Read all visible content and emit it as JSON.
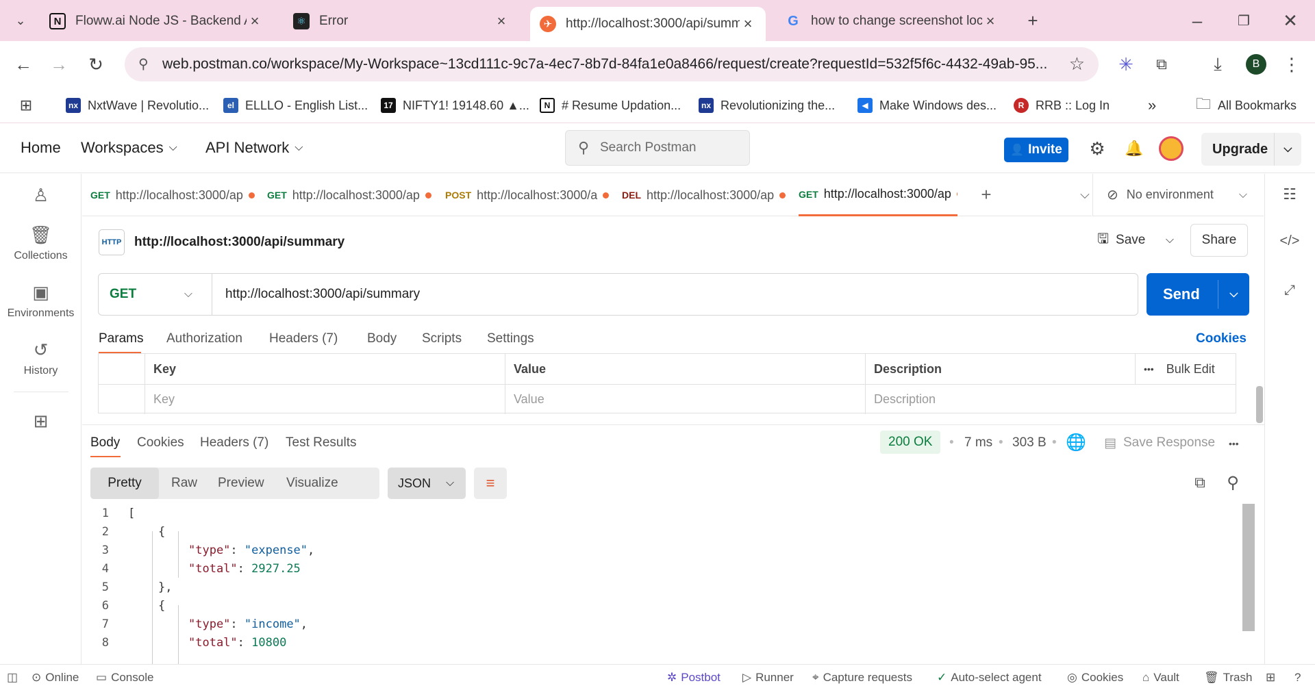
{
  "browser": {
    "tabs": [
      {
        "title": "Floww.ai Node JS - Backend As",
        "icon": "notion-icon"
      },
      {
        "title": "Error",
        "icon": "react-icon"
      },
      {
        "title": "http://localhost:3000/api/summ",
        "icon": "postman-icon",
        "active": true
      },
      {
        "title": "how to change screenshot locat",
        "icon": "google-icon"
      }
    ],
    "url": "web.postman.co/workspace/My-Workspace~13cd111c-9c7a-4ec7-8b7d-84fa1e0a8466/request/create?requestId=532f5f6c-4432-49ab-95...",
    "profile_initial": "B",
    "bookmarks": [
      {
        "label": "NxtWave | Revolutio...",
        "color": "#1f3a93"
      },
      {
        "label": "ELLLO - English List...",
        "color": "#2b5fb3"
      },
      {
        "label": "NIFTY1! 19148.60 ▲...",
        "color": "#111111"
      },
      {
        "label": "# Resume Updation...",
        "color": "#111111"
      },
      {
        "label": "Revolutionizing the...",
        "color": "#1f3a93"
      },
      {
        "label": "Make Windows des...",
        "color": "#1a73e8"
      },
      {
        "label": "RRB :: Log In",
        "color": "#c62828"
      }
    ],
    "all_bookmarks": "All Bookmarks"
  },
  "postman": {
    "nav": {
      "home": "Home",
      "workspaces": "Workspaces",
      "api_network": "API Network"
    },
    "search_placeholder": "Search Postman",
    "invite": "Invite",
    "upgrade": "Upgrade",
    "sidebar": [
      {
        "label": "",
        "icon": "user-icon"
      },
      {
        "label": "Collections",
        "icon": "collections-icon"
      },
      {
        "label": "Environments",
        "icon": "environments-icon"
      },
      {
        "label": "History",
        "icon": "history-icon"
      },
      {
        "label": "",
        "icon": "apps-icon"
      }
    ],
    "request_tabs": [
      {
        "method": "GET",
        "url": "http://localhost:3000/ap",
        "method_color": "#0b7d3e"
      },
      {
        "method": "GET",
        "url": "http://localhost:3000/ap",
        "method_color": "#0b7d3e"
      },
      {
        "method": "POST",
        "url": "http://localhost:3000/a",
        "method_color": "#ad7a03"
      },
      {
        "method": "DEL",
        "url": "http://localhost:3000/ap",
        "method_color": "#8e1a10"
      },
      {
        "method": "GET",
        "url": "http://localhost:3000/ap",
        "method_color": "#0b7d3e",
        "active": true
      }
    ],
    "environment": "No environment",
    "request": {
      "title": "http://localhost:3000/api/summary",
      "save": "Save",
      "share": "Share",
      "method": "GET",
      "url": "http://localhost:3000/api/summary",
      "send": "Send",
      "tabs": [
        "Params",
        "Authorization",
        "Headers (7)",
        "Body",
        "Scripts",
        "Settings"
      ],
      "cookies": "Cookies",
      "params": {
        "headers": [
          "Key",
          "Value",
          "Description"
        ],
        "bulk_edit": "Bulk Edit",
        "placeholders": [
          "Key",
          "Value",
          "Description"
        ]
      }
    },
    "response": {
      "tabs": [
        "Body",
        "Cookies",
        "Headers (7)",
        "Test Results"
      ],
      "status": "200 OK",
      "time": "7 ms",
      "size": "303 B",
      "save_response": "Save Response",
      "views": [
        "Pretty",
        "Raw",
        "Preview",
        "Visualize"
      ],
      "format": "JSON",
      "lines": [
        {
          "n": "1",
          "text": "["
        },
        {
          "n": "2",
          "text": "{"
        },
        {
          "n": "3",
          "key": "\"type\"",
          "val": "\"expense\"",
          "tail": ","
        },
        {
          "n": "4",
          "key": "\"total\"",
          "num": "2927.25",
          "tail": ""
        },
        {
          "n": "5",
          "text": "},"
        },
        {
          "n": "6",
          "text": "{"
        },
        {
          "n": "7",
          "key": "\"type\"",
          "val": "\"income\"",
          "tail": ","
        },
        {
          "n": "8",
          "key": "\"total\"",
          "num": "10800",
          "tail": ""
        }
      ]
    },
    "footer": {
      "online": "Online",
      "console": "Console",
      "postbot": "Postbot",
      "runner": "Runner",
      "capture": "Capture requests",
      "agent": "Auto-select agent",
      "cookies": "Cookies",
      "vault": "Vault",
      "trash": "Trash"
    }
  }
}
